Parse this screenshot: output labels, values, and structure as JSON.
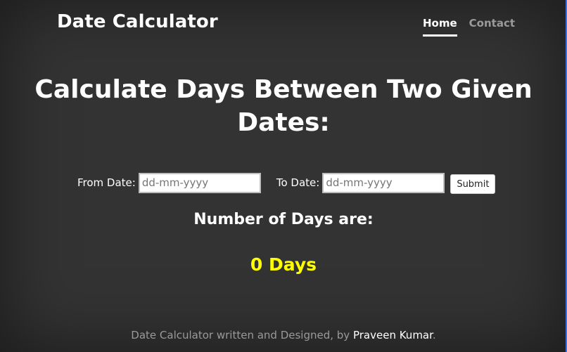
{
  "header": {
    "brand": "Date Calculator",
    "nav": [
      {
        "label": "Home",
        "active": true
      },
      {
        "label": "Contact",
        "active": false
      }
    ]
  },
  "main": {
    "heading": "Calculate Days Between Two Given Dates:",
    "form": {
      "from_label": "From Date:",
      "from_placeholder": "dd-mm-yyyy",
      "to_label": "To Date:",
      "to_placeholder": "dd-mm-yyyy",
      "submit_label": "Submit"
    },
    "result_label": "Number of Days are:",
    "result_value": "0 Days"
  },
  "footer": {
    "text_before": "Date Calculator written and Designed, by ",
    "author": "Praveen Kumar",
    "text_after": "."
  },
  "colors": {
    "background": "#333333",
    "result": "#ffff00",
    "muted_text": "#9a9a9a"
  }
}
